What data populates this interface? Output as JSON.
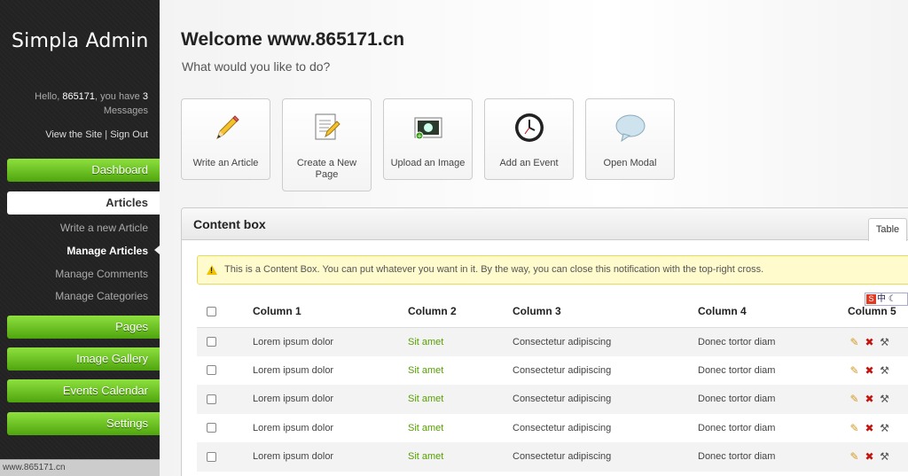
{
  "sidebar": {
    "brand": "Simpla Admin",
    "profile": {
      "hello": "Hello, ",
      "user": "865171",
      "you_have": ", you have ",
      "count": "3",
      "messages": "Messages"
    },
    "links": {
      "view_site": "View the Site",
      "separator": " | ",
      "sign_out": "Sign Out"
    },
    "nav": {
      "dashboard": "Dashboard",
      "articles": "Articles",
      "articles_sub": [
        "Write a new Article",
        "Manage Articles",
        "Manage Comments",
        "Manage Categories"
      ],
      "pages": "Pages",
      "image_gallery": "Image Gallery",
      "events_calendar": "Events Calendar",
      "settings": "Settings"
    }
  },
  "main": {
    "welcome": "Welcome www.865171.cn",
    "subtitle": "What would you like to do?",
    "shortcuts": [
      "Write an Article",
      "Create a New Page",
      "Upload an Image",
      "Add an Event",
      "Open Modal"
    ]
  },
  "content_box": {
    "title": "Content box",
    "tab": "Table",
    "notice": "This is a Content Box. You can put whatever you want in it. By the way, you can close this notification with the top-right cross.",
    "columns": [
      "Column 1",
      "Column 2",
      "Column 3",
      "Column 4",
      "Column 5"
    ],
    "rows": [
      [
        "Lorem ipsum dolor",
        "Sit amet",
        "Consectetur adipiscing",
        "Donec tortor diam"
      ],
      [
        "Lorem ipsum dolor",
        "Sit amet",
        "Consectetur adipiscing",
        "Donec tortor diam"
      ],
      [
        "Lorem ipsum dolor",
        "Sit amet",
        "Consectetur adipiscing",
        "Donec tortor diam"
      ],
      [
        "Lorem ipsum dolor",
        "Sit amet",
        "Consectetur adipiscing",
        "Donec tortor diam"
      ],
      [
        "Lorem ipsum dolor",
        "Sit amet",
        "Consectetur adipiscing",
        "Donec tortor diam"
      ]
    ]
  },
  "status_bar": "www.865171.cn",
  "ime": "中"
}
